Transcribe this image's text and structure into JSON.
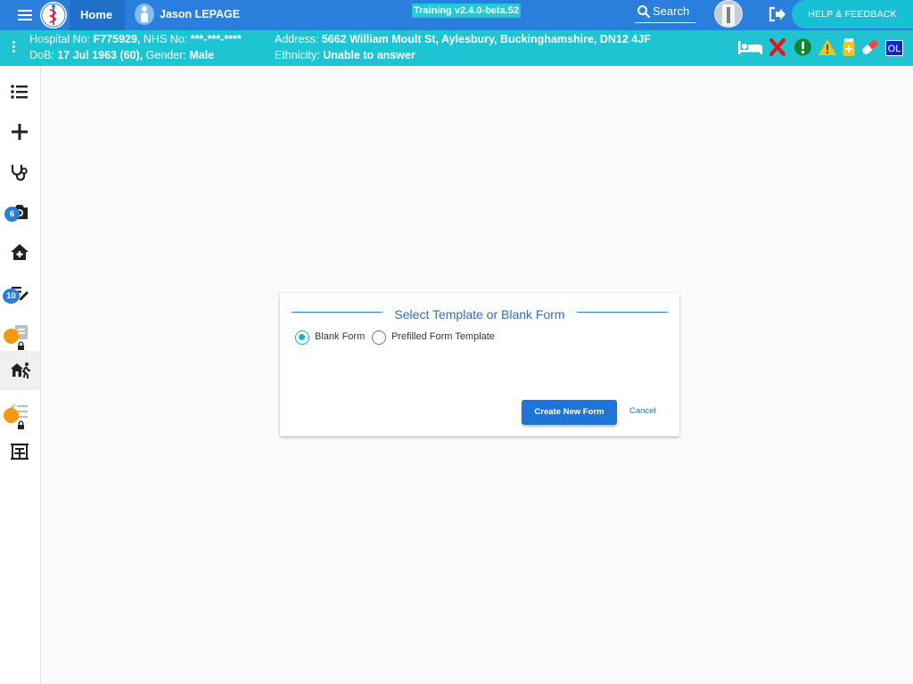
{
  "topbar": {
    "home_label": "Home",
    "patient_name": "Jason LEPAGE",
    "version": "Training v2.4.0-beta.52",
    "search_label": "Search",
    "help_label": "HELP & FEEDBACK"
  },
  "banner": {
    "hospital_no_label": "Hospital No:",
    "hospital_no": "F775929,",
    "nhs_no_label": "NHS No:",
    "nhs_no": "***-***-****",
    "dob_label": "DoB:",
    "dob": "17 Jul 1963 (60),",
    "gender_label": "Gender:",
    "gender": "Male",
    "address_label": "Address:",
    "address": "5662 William Moult St, Aylesbury, Buckinghamshire, DN12 4JF",
    "ethnicity_label": "Ethnicity:",
    "ethnicity": "Unable to answer",
    "ol_badge": "OL",
    "icons": [
      "bed-icon",
      "x-mark-icon",
      "alert-circle-icon",
      "warning-triangle-icon",
      "medication-bottle-icon",
      "pill-icon"
    ]
  },
  "sidebar": {
    "items": [
      {
        "icon": "list-icon"
      },
      {
        "icon": "plus-icon"
      },
      {
        "icon": "stethoscope-icon"
      },
      {
        "icon": "camera-icon",
        "badge": "6"
      },
      {
        "icon": "home-plus-icon"
      },
      {
        "icon": "edit-note-icon",
        "badge": "10"
      },
      {
        "icon": "forms-icon",
        "locked": true
      },
      {
        "icon": "home-walk-icon",
        "active": true
      },
      {
        "icon": "checklist-icon",
        "locked": true
      },
      {
        "icon": "ward-icon"
      }
    ]
  },
  "dialog": {
    "title": "Select Template or Blank Form",
    "options": [
      {
        "label": "Blank Form",
        "checked": true
      },
      {
        "label": "Prefilled Form Template",
        "checked": false
      }
    ],
    "create_label": "Create New Form",
    "cancel_label": "Cancel"
  },
  "colors": {
    "topbar": "#2b7fdc",
    "banner": "#1fc4d3",
    "primary_button": "#1f74d6",
    "radio_checked": "#17b3c3",
    "lock_badge": "#f39a12"
  }
}
